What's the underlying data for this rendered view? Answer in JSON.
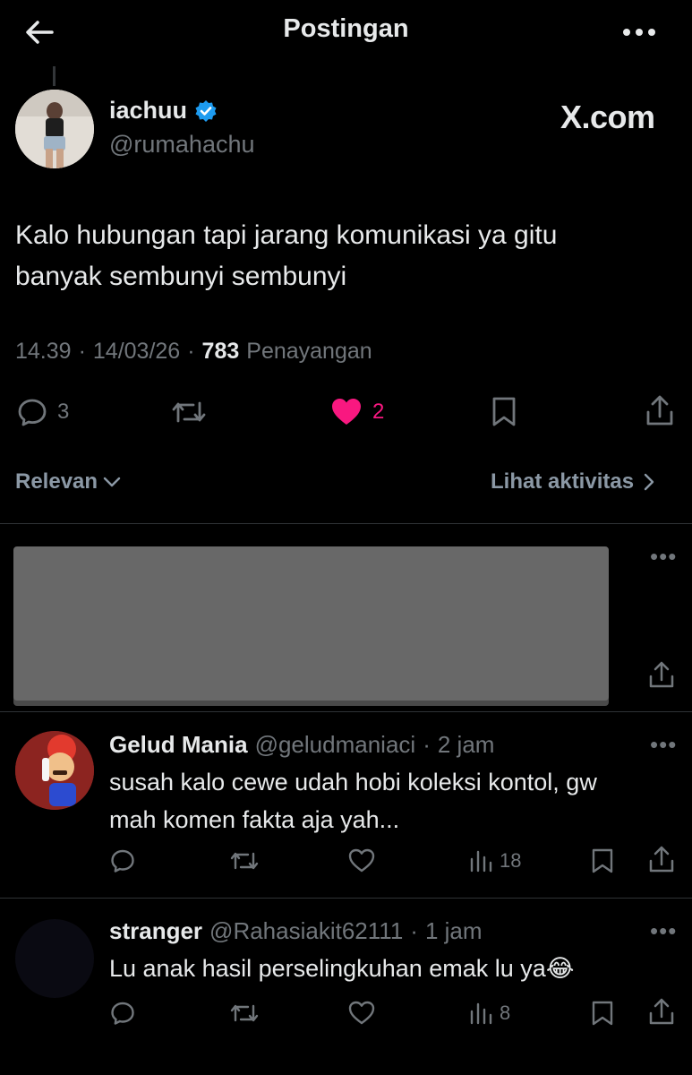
{
  "header": {
    "title": "Postingan"
  },
  "post": {
    "author_name": "iachuu",
    "author_handle": "@rumahachu",
    "watermark": "X.com",
    "text_line1": "Kalo hubungan tapi jarang komunikasi ya gitu",
    "text_line2": "banyak sembunyi sembunyi",
    "time": "14.39",
    "date": "14/03/26",
    "views": "783",
    "views_label": "Penayangan",
    "reply_count": "3",
    "like_count": "2",
    "colors": {
      "like": "#f91880",
      "verified": "#1d9bf0"
    }
  },
  "filter": {
    "sort_label": "Relevan",
    "activity_label": "Lihat aktivitas"
  },
  "replies": [
    {
      "name": "Gelud Mania",
      "handle": "@geludmaniaci",
      "time": "2 jam",
      "text_line1": "susah kalo cewe udah hobi koleksi kontol, gw",
      "text_line2": "mah komen fakta aja yah...",
      "views": "18"
    },
    {
      "name": "stranger",
      "handle": "@Rahasiakit62111",
      "time": "1 jam",
      "text_line1": "Lu anak hasil perselingkuhan emak lu ya",
      "emoji": "😂",
      "views": "8"
    }
  ]
}
